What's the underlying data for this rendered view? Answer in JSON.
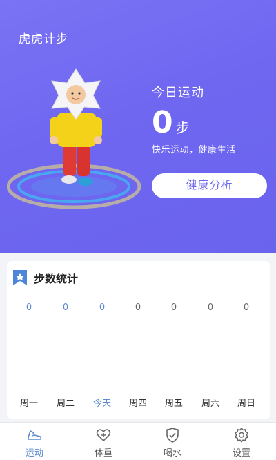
{
  "header": {
    "app_title": "虎虎计步"
  },
  "today": {
    "label": "今日运动",
    "steps": "0",
    "unit": "步",
    "slogan": "快乐运动，健康生活",
    "analysis_button": "健康分析"
  },
  "weekly": {
    "title": "步数统计",
    "days": [
      {
        "label": "周一",
        "value": "0"
      },
      {
        "label": "周二",
        "value": "0"
      },
      {
        "label": "今天",
        "value": "0"
      },
      {
        "label": "周四",
        "value": "0"
      },
      {
        "label": "周五",
        "value": "0"
      },
      {
        "label": "周六",
        "value": "0"
      },
      {
        "label": "周日",
        "value": "0"
      }
    ]
  },
  "nav": {
    "items": [
      {
        "label": "运动",
        "icon": "sneaker-icon",
        "active": true
      },
      {
        "label": "体重",
        "icon": "heart-plus-icon",
        "active": false
      },
      {
        "label": "喝水",
        "icon": "shield-check-icon",
        "active": false
      },
      {
        "label": "设置",
        "icon": "gear-icon",
        "active": false
      }
    ]
  },
  "colors": {
    "hero_bg": "#6f67f0",
    "accent": "#5b8bd0",
    "card_bg": "#ffffff"
  }
}
